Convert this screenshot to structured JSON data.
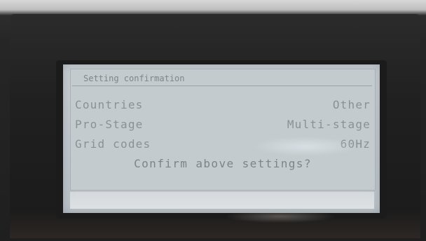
{
  "screen": {
    "title": "Setting confirmation",
    "rows": [
      {
        "label": "Countries",
        "value": "Other"
      },
      {
        "label": "Pro-Stage",
        "value": "Multi-stage"
      },
      {
        "label": "Grid codes",
        "value": "60Hz"
      }
    ],
    "prompt": "Confirm above settings?"
  },
  "colors": {
    "lcd_background": "#c4cbcf",
    "lcd_text": "#8a9196",
    "bezel": "#202020"
  }
}
